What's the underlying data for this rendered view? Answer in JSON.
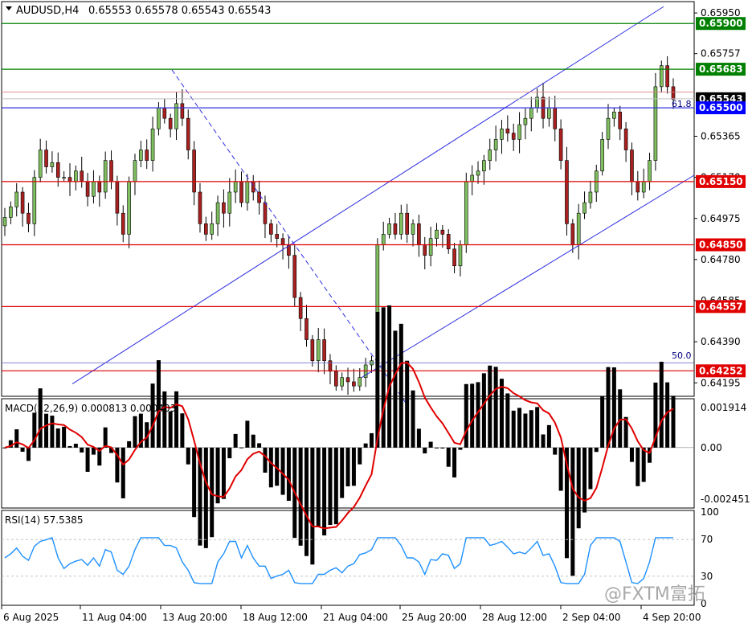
{
  "header": {
    "symbol_tf": "AUDUSD,H4",
    "ohlc": "0.65553 0.65578 0.65543 0.65543"
  },
  "watermark": "@FXTM富拓",
  "colors": {
    "bull": "#90c090",
    "bear": "#ff9800",
    "candle_bull": "#7fbf5f",
    "candle_bear": "#a82020",
    "support": "#e00000",
    "resistance": "#008000",
    "channel": "#3030e0",
    "signal": "#e00000",
    "rsi": "#1e90ff"
  },
  "chart_data": [
    {
      "type": "candlestick",
      "title": "AUDUSD,H4",
      "y_ticks": [
        "0.65950",
        "0.65757",
        "0.65365",
        "0.65170",
        "0.64975",
        "0.64780",
        "0.64585",
        "0.64390",
        "0.64195"
      ],
      "ylim": [
        0.64135,
        0.66
      ],
      "x_ticks": [
        "6 Aug 2025",
        "11 Aug 04:00",
        "13 Aug 20:00",
        "18 Aug 12:00",
        "21 Aug 04:00",
        "25 Aug 20:00",
        "28 Aug 12:00",
        "2 Sep 04:00",
        "4 Sep 20:00"
      ],
      "levels": [
        {
          "label": "0.65900",
          "value": 0.659,
          "kind": "resistance"
        },
        {
          "label": "0.65683",
          "value": 0.65683,
          "kind": "resistance"
        },
        {
          "label": "0.65543",
          "value": 0.65543,
          "kind": "current"
        },
        {
          "label": "0.65500",
          "value": 0.655,
          "kind": "fib"
        },
        {
          "label": "0.65150",
          "value": 0.6515,
          "kind": "support"
        },
        {
          "label": "0.64850",
          "value": 0.6485,
          "kind": "support"
        },
        {
          "label": "0.64557",
          "value": 0.64557,
          "kind": "support"
        },
        {
          "label": "0.64252",
          "value": 0.64252,
          "kind": "support"
        }
      ],
      "fib_labels": [
        "61.8",
        "50.0"
      ],
      "series_close": [
        0.6498,
        0.6503,
        0.651,
        0.65,
        0.6495,
        0.6517,
        0.653,
        0.6522,
        0.6524,
        0.6517,
        0.6517,
        0.6515,
        0.652,
        0.6515,
        0.6508,
        0.6515,
        0.651,
        0.6525,
        0.6515,
        0.65,
        0.649,
        0.6515,
        0.6525,
        0.653,
        0.6525,
        0.654,
        0.655,
        0.6545,
        0.654,
        0.6552,
        0.6545,
        0.653,
        0.651,
        0.6495,
        0.649,
        0.6495,
        0.6505,
        0.65,
        0.651,
        0.6515,
        0.6505,
        0.6515,
        0.651,
        0.6505,
        0.6495,
        0.649,
        0.6488,
        0.6485,
        0.648,
        0.646,
        0.645,
        0.644,
        0.643,
        0.644,
        0.643,
        0.6425,
        0.6418,
        0.6422,
        0.642,
        0.6418,
        0.6422,
        0.6428,
        0.643,
        0.6485,
        0.649,
        0.6495,
        0.649,
        0.65,
        0.649,
        0.6495,
        0.6485,
        0.648,
        0.6488,
        0.6492,
        0.649,
        0.6483,
        0.6475,
        0.6485,
        0.6515,
        0.6518,
        0.652,
        0.6525,
        0.653,
        0.6535,
        0.654,
        0.6538,
        0.6535,
        0.6542,
        0.6545,
        0.655,
        0.6555,
        0.6545,
        0.655,
        0.654,
        0.6525,
        0.6495,
        0.6485,
        0.65,
        0.6505,
        0.651,
        0.652,
        0.6535,
        0.6545,
        0.6548,
        0.654,
        0.653,
        0.6515,
        0.651,
        0.6515,
        0.6525,
        0.656,
        0.657,
        0.656,
        0.6554
      ],
      "macd": {
        "label": "MACD(12,26,9) 0.000813 0.000403",
        "y_ticks": [
          "0.001914",
          "0.00",
          "-0.002451"
        ],
        "ylim": [
          -0.0028,
          0.00225
        ]
      },
      "rsi": {
        "label": "RSI(14) 57.5385",
        "y_ticks": [
          "100",
          "70",
          "30",
          "0"
        ],
        "levels": [
          70,
          30
        ],
        "ylim": [
          0,
          100
        ]
      }
    }
  ]
}
